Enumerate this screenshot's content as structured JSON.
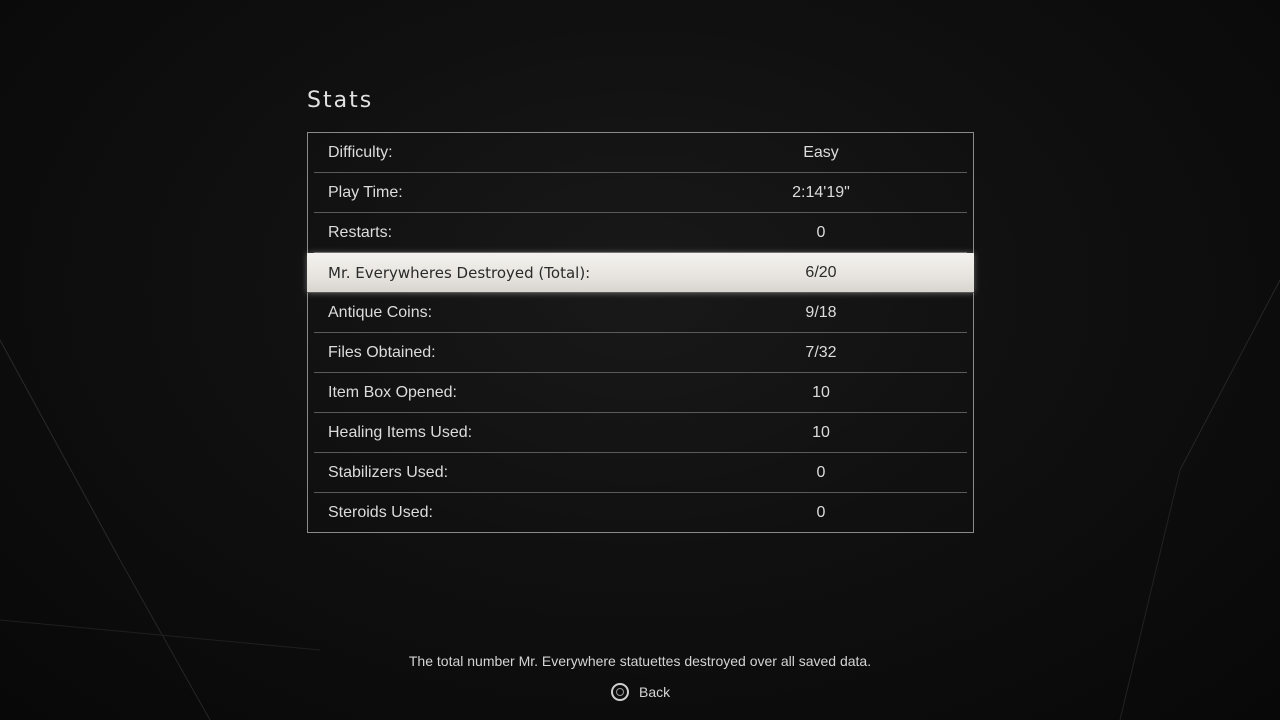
{
  "screen": {
    "title": "Stats"
  },
  "stats": [
    {
      "label": "Difficulty:",
      "value": "Easy",
      "selected": false
    },
    {
      "label": "Play Time:",
      "value": "2:14'19\"",
      "selected": false
    },
    {
      "label": "Restarts:",
      "value": "0",
      "selected": false
    },
    {
      "label": "Mr. Everywheres Destroyed (Total):",
      "value": "6/20",
      "selected": true
    },
    {
      "label": "Antique Coins:",
      "value": "9/18",
      "selected": false
    },
    {
      "label": "Files Obtained:",
      "value": "7/32",
      "selected": false
    },
    {
      "label": "Item Box Opened:",
      "value": "10",
      "selected": false
    },
    {
      "label": "Healing Items Used:",
      "value": "10",
      "selected": false
    },
    {
      "label": "Stabilizers Used:",
      "value": "0",
      "selected": false
    },
    {
      "label": "Steroids Used:",
      "value": "0",
      "selected": false
    }
  ],
  "footer": {
    "description": "The total number Mr. Everywhere statuettes destroyed over all saved data.",
    "back_label": "Back",
    "back_icon": "circle-button-icon"
  },
  "colors": {
    "background": "#0c0c0c",
    "highlight": "#efece7",
    "text": "#dcdcdc",
    "border": "#8a8a8a"
  }
}
